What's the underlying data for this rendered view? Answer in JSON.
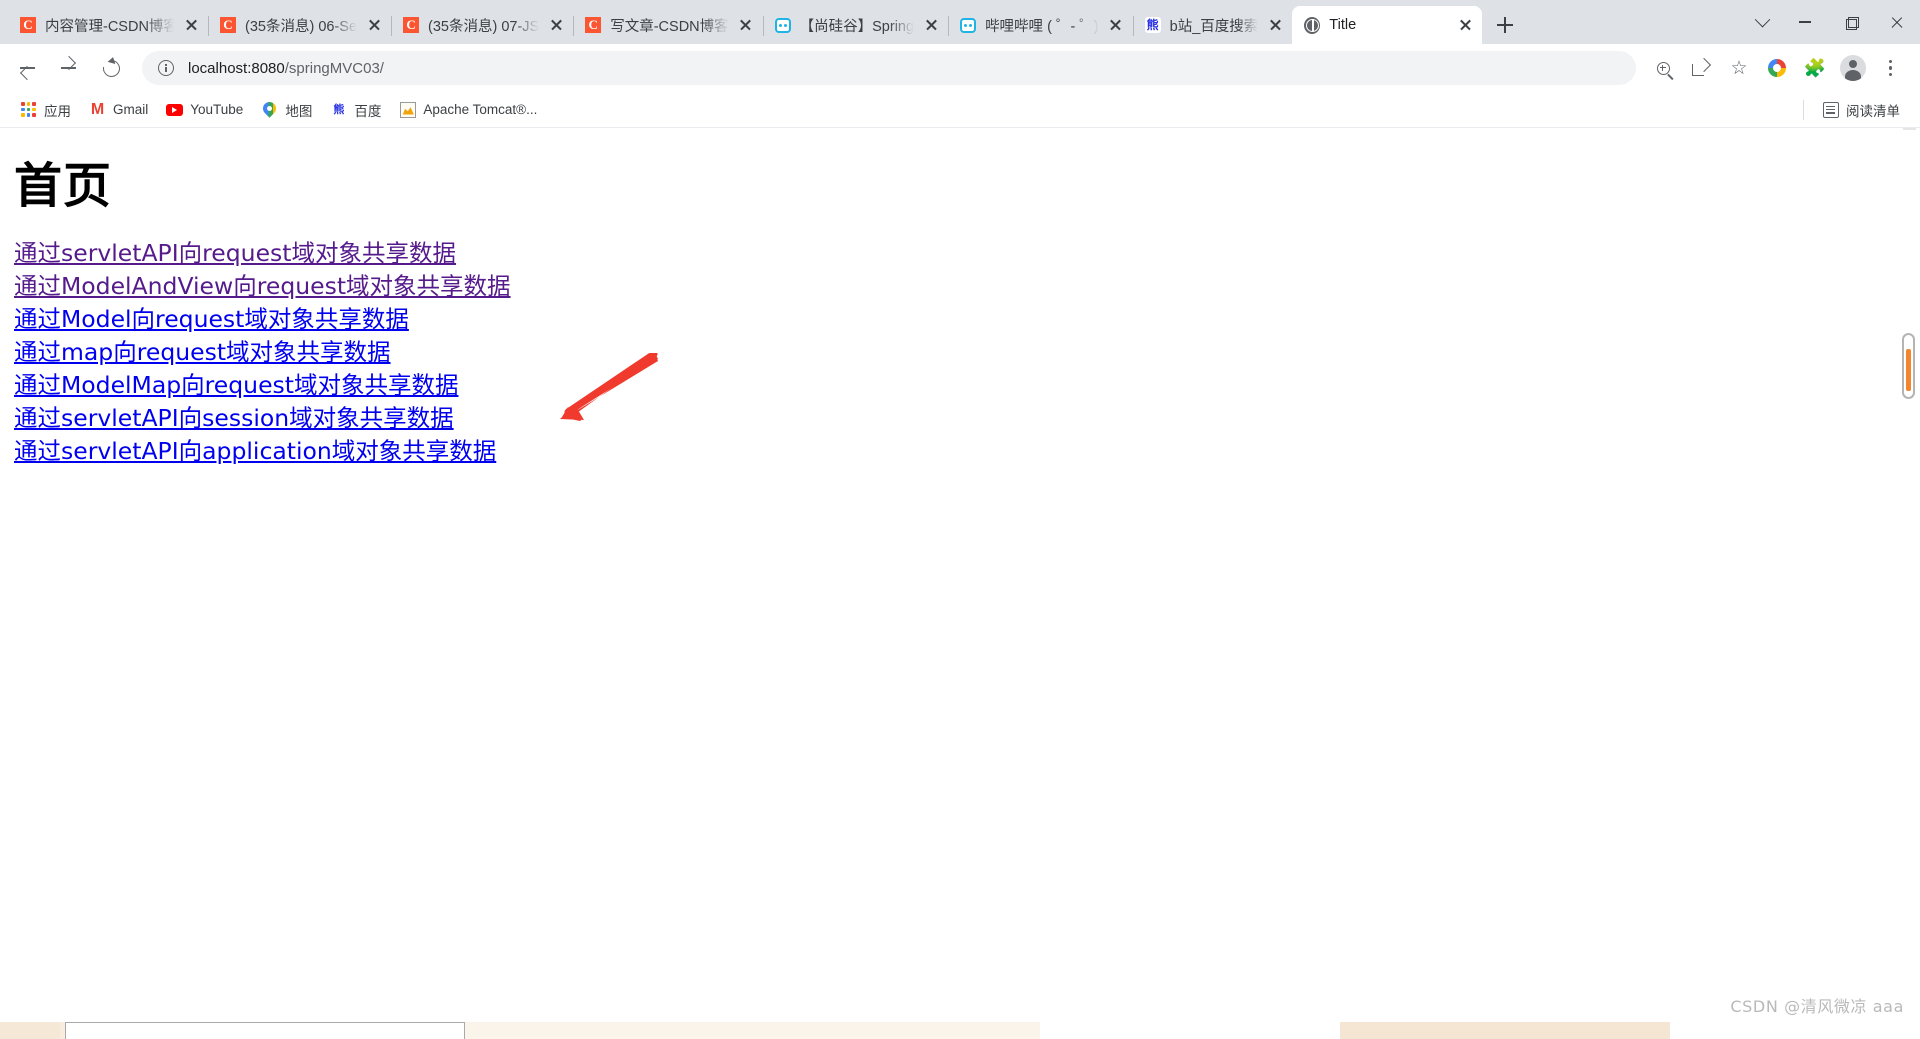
{
  "window": {
    "controls": {
      "minimize": "minimize",
      "maximize": "restore",
      "close": "close"
    }
  },
  "tabstrip": {
    "tabs": [
      {
        "title": "内容管理-CSDN博客",
        "favicon": "csdn-icon",
        "active": false
      },
      {
        "title": "(35条消息) 06-Se",
        "favicon": "csdn-icon",
        "active": false
      },
      {
        "title": "(35条消息) 07-JS",
        "favicon": "csdn-icon",
        "active": false
      },
      {
        "title": "写文章-CSDN博客",
        "favicon": "csdn-icon",
        "active": false
      },
      {
        "title": "【尚硅谷】Spring",
        "favicon": "bilibili-icon",
        "active": false
      },
      {
        "title": "哔哩哔哩 ( ゜- ゜)",
        "favicon": "bilibili-icon",
        "active": false
      },
      {
        "title": "b站_百度搜索",
        "favicon": "baidu-icon",
        "active": false
      },
      {
        "title": "Title",
        "favicon": "globe-icon",
        "active": true
      }
    ],
    "new_tab_label": "+",
    "tab_search_label": "搜索标签页"
  },
  "toolbar": {
    "back_label": "后退",
    "forward_label": "前进",
    "reload_label": "重新加载",
    "url": {
      "host": "localhost:8080",
      "path": "/springMVC03/",
      "full": "localhost:8080/springMVC03/"
    },
    "site_info_label": "查看网站信息",
    "actions": [
      {
        "name": "zoom-icon",
        "label": "缩放"
      },
      {
        "name": "share-icon",
        "label": "分享"
      },
      {
        "name": "star-icon",
        "label": "将此标签页加入书签",
        "glyph": "☆"
      },
      {
        "name": "google-icon",
        "label": "Google"
      },
      {
        "name": "extensions-icon",
        "label": "扩展程序",
        "glyph": "🧩"
      },
      {
        "name": "profile-icon",
        "label": "个人资料"
      },
      {
        "name": "menu-icon",
        "label": "自定义及控制"
      }
    ]
  },
  "bookmarks": {
    "items": [
      {
        "label": "应用",
        "icon": "apps-grid-icon"
      },
      {
        "label": "Gmail",
        "icon": "gmail-icon"
      },
      {
        "label": "YouTube",
        "icon": "youtube-icon"
      },
      {
        "label": "地图",
        "icon": "maps-pin-icon"
      },
      {
        "label": "百度",
        "icon": "baidu-icon"
      },
      {
        "label": "Apache Tomcat®...",
        "icon": "tomcat-icon"
      }
    ],
    "reading_list": {
      "label": "阅读清单",
      "icon": "reading-list-icon"
    }
  },
  "page": {
    "heading": "首页",
    "links": [
      {
        "text": "通过servletAPI向request域对象共享数据",
        "state": "visited"
      },
      {
        "text": "通过ModelAndView向request域对象共享数据",
        "state": "visited"
      },
      {
        "text": "通过Model向request域对象共享数据",
        "state": "unvisited"
      },
      {
        "text": "通过map向request域对象共享数据",
        "state": "unvisited"
      },
      {
        "text": "通过ModelMap向request域对象共享数据",
        "state": "unvisited"
      },
      {
        "text": "通过servletAPI向session域对象共享数据",
        "state": "unvisited"
      },
      {
        "text": "通过servletAPI向application域对象共享数据",
        "state": "unvisited"
      }
    ],
    "annotation": {
      "type": "red-arrow",
      "color": "#f03a2e",
      "points_to": "通过ModelAndView向request域对象共享数据"
    }
  },
  "scrollbar": {
    "marker_color": "#f2862c"
  },
  "watermark": {
    "text": "CSDN @清风微凉 aaa"
  },
  "colors": {
    "chrome_bg": "#dee1e6",
    "toolbar_bg": "#ffffff",
    "omnibox_bg": "#f1f3f4",
    "link_visited": "#551a8b",
    "link_unvisited": "#0000ee",
    "annotation_red": "#f03a2e",
    "watermark_gray": "#b9b9b9"
  }
}
